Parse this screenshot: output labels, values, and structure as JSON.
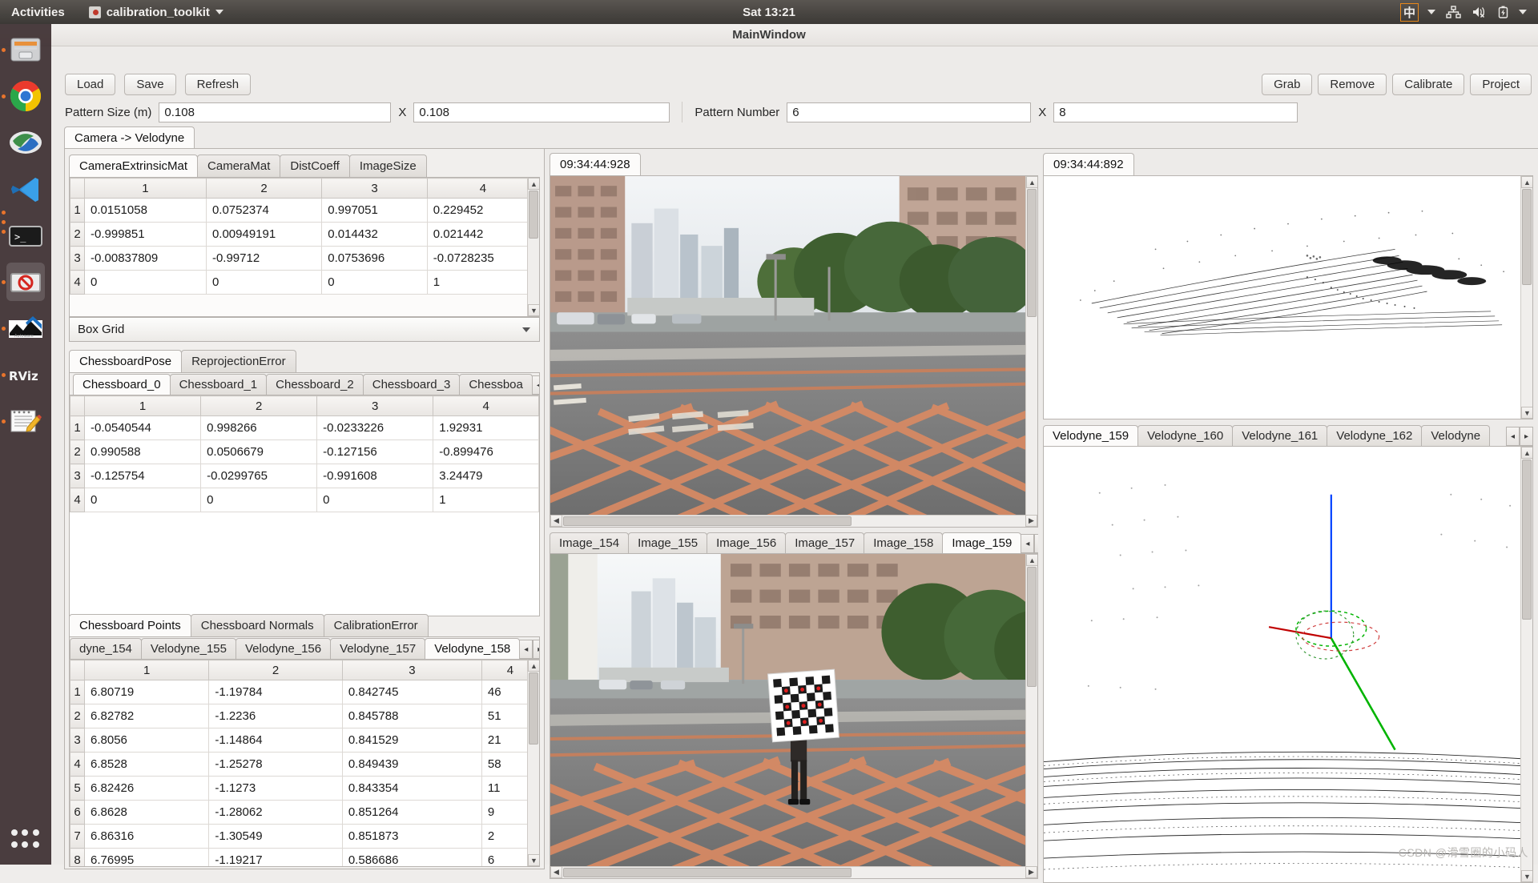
{
  "desktop": {
    "activities": "Activities",
    "app_menu": "calibration_toolkit",
    "clock": "Sat 13:21",
    "tray": {
      "input_method": "中",
      "network_icon": "network-icon",
      "volume_icon": "volume-muted-icon",
      "battery_icon": "battery-charging-icon"
    },
    "dock_items": [
      {
        "name": "files-icon",
        "label": "Files"
      },
      {
        "name": "chrome-icon",
        "label": "Google Chrome"
      },
      {
        "name": "system-settings-icon",
        "label": "System Settings"
      },
      {
        "name": "vscode-icon",
        "label": "Visual Studio Code"
      },
      {
        "name": "terminal-icon",
        "label": "Terminal"
      },
      {
        "name": "calibration-toolkit-icon",
        "label": "calibration_toolkit"
      },
      {
        "name": "autoware-icon",
        "label": "Autoware"
      },
      {
        "name": "rviz-icon",
        "label": "RViz"
      },
      {
        "name": "text-editor-icon",
        "label": "Text Editor"
      },
      {
        "name": "show-applications-icon",
        "label": "Show Applications"
      }
    ]
  },
  "window": {
    "title": "MainWindow"
  },
  "toolbar": {
    "load": "Load",
    "save": "Save",
    "refresh": "Refresh",
    "grab": "Grab",
    "remove": "Remove",
    "calibrate": "Calibrate",
    "project": "Project",
    "pattern_size_label": "Pattern Size (m)",
    "pattern_size_w": "0.108",
    "pattern_size_x": "X",
    "pattern_size_h": "0.108",
    "pattern_number_label": "Pattern Number",
    "pattern_number_w": "6",
    "pattern_number_x": "X",
    "pattern_number_h": "8"
  },
  "main_tab": {
    "label": "Camera -> Velodyne"
  },
  "matrix_tabs": {
    "items": [
      "CameraExtrinsicMat",
      "CameraMat",
      "DistCoeff",
      "ImageSize"
    ],
    "selected": "CameraExtrinsicMat"
  },
  "extrinsic_table": {
    "columns": [
      "1",
      "2",
      "3",
      "4"
    ],
    "rows": [
      {
        "n": "1",
        "cells": [
          "0.0151058",
          "0.0752374",
          "0.997051",
          "0.229452"
        ]
      },
      {
        "n": "2",
        "cells": [
          "-0.999851",
          "0.00949191",
          "0.014432",
          "0.021442"
        ]
      },
      {
        "n": "3",
        "cells": [
          "-0.00837809",
          "-0.99712",
          "0.0753696",
          "-0.0728235"
        ]
      },
      {
        "n": "4",
        "cells": [
          "0",
          "0",
          "0",
          "1"
        ]
      }
    ]
  },
  "grid_combo": {
    "value": "Box Grid"
  },
  "pose_tabs": {
    "items": [
      "ChessboardPose",
      "ReprojectionError"
    ],
    "selected": "ChessboardPose"
  },
  "chessboard_tabs": {
    "items": [
      "Chessboard_0",
      "Chessboard_1",
      "Chessboard_2",
      "Chessboard_3",
      "Chessboa"
    ],
    "selected": "Chessboard_0",
    "prev": "◂",
    "next": "▸"
  },
  "pose_table": {
    "columns": [
      "1",
      "2",
      "3",
      "4"
    ],
    "rows": [
      {
        "n": "1",
        "cells": [
          "-0.0540544",
          "0.998266",
          "-0.0233226",
          "1.92931"
        ]
      },
      {
        "n": "2",
        "cells": [
          "0.990588",
          "0.0506679",
          "-0.127156",
          "-0.899476"
        ]
      },
      {
        "n": "3",
        "cells": [
          "-0.125754",
          "-0.0299765",
          "-0.991608",
          "3.24479"
        ]
      },
      {
        "n": "4",
        "cells": [
          "0",
          "0",
          "0",
          "1"
        ]
      }
    ]
  },
  "points_tabs": {
    "items": [
      "Chessboard Points",
      "Chessboard Normals",
      "CalibrationError"
    ],
    "selected": "Chessboard Points"
  },
  "velodyne_points_tabs": {
    "items": [
      "dyne_154",
      "Velodyne_155",
      "Velodyne_156",
      "Velodyne_157",
      "Velodyne_158"
    ],
    "selected": "Velodyne_158",
    "prev": "◂",
    "next": "▸"
  },
  "points_table": {
    "columns": [
      "1",
      "2",
      "3",
      "4"
    ],
    "rows": [
      {
        "n": "1",
        "cells": [
          "6.80719",
          "-1.19784",
          "0.842745",
          "46"
        ]
      },
      {
        "n": "2",
        "cells": [
          "6.82782",
          "-1.2236",
          "0.845788",
          "51"
        ]
      },
      {
        "n": "3",
        "cells": [
          "6.8056",
          "-1.14864",
          "0.841529",
          "21"
        ]
      },
      {
        "n": "4",
        "cells": [
          "6.8528",
          "-1.25278",
          "0.849439",
          "58"
        ]
      },
      {
        "n": "5",
        "cells": [
          "6.82426",
          "-1.1273",
          "0.843354",
          "11"
        ]
      },
      {
        "n": "6",
        "cells": [
          "6.8628",
          "-1.28062",
          "0.851264",
          "9"
        ]
      },
      {
        "n": "7",
        "cells": [
          "6.86316",
          "-1.30549",
          "0.851873",
          "2"
        ]
      },
      {
        "n": "8",
        "cells": [
          "6.76995",
          "-1.19217",
          "0.586686",
          "6"
        ]
      }
    ]
  },
  "camera_view": {
    "timestamp_tab": "09:34:44:928",
    "image_tabs": {
      "items": [
        "Image_154",
        "Image_155",
        "Image_156",
        "Image_157",
        "Image_158",
        "Image_159"
      ],
      "selected": "Image_159",
      "prev": "◂",
      "next": "▸"
    }
  },
  "lidar_view": {
    "timestamp_tab": "09:34:44:892",
    "velodyne_tabs": {
      "items": [
        "Velodyne_159",
        "Velodyne_160",
        "Velodyne_161",
        "Velodyne_162",
        "Velodyne"
      ],
      "selected": "Velodyne_159",
      "prev": "◂",
      "next": "▸"
    }
  },
  "watermark": "CSDN @滑雪圈的小码人",
  "colors": {
    "accent": "#e8742c",
    "panel_bg": "#fcfbfa",
    "border": "#b8b4b0",
    "axis_x": "#00b400",
    "axis_y": "#c00000",
    "axis_z": "#0040ff"
  }
}
